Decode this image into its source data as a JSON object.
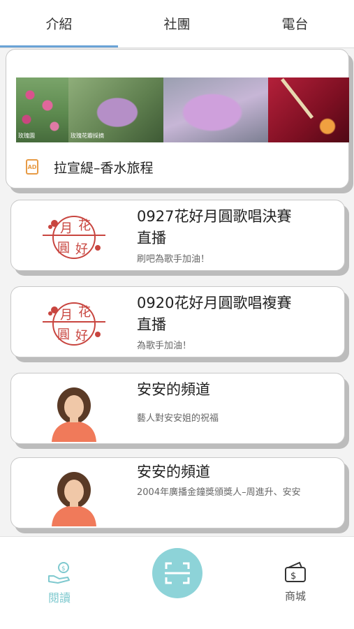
{
  "tabs": [
    "介紹",
    "社團",
    "電台"
  ],
  "ad": {
    "badge": "AD",
    "title": "拉宣緹–香水旅程",
    "captions": [
      "玫瑰園",
      "玫瑰花瓣採摘"
    ]
  },
  "items": [
    {
      "title_lines": [
        "0927花好月圓歌唱決賽",
        "直播"
      ],
      "subtitle": "刷吧為歌手加油！",
      "logo_text": [
        "月",
        "花",
        "圓",
        "好"
      ]
    },
    {
      "title_lines": [
        "0920花好月圓歌唱複賽",
        "直播"
      ],
      "subtitle": "為歌手加油！",
      "logo_text": [
        "月",
        "花",
        "圓",
        "好"
      ]
    },
    {
      "title_lines": [
        "安安的頻道"
      ],
      "subtitle": "藝人對安安姐的祝福"
    },
    {
      "title_lines": [
        "安安的頻道"
      ],
      "subtitle": "2004年廣播金鐘獎頒獎人–周進升、安安"
    }
  ],
  "nav": {
    "read_label": "閱讀",
    "shop_label": "商城",
    "read_icon": "hand-coin-icon",
    "scan_icon": "scan-icon",
    "shop_icon": "wallet-dollar-icon"
  },
  "colors": {
    "accent": "#6aa3d6",
    "teal": "#8dd3d8",
    "logo_red": "#c8453f"
  }
}
